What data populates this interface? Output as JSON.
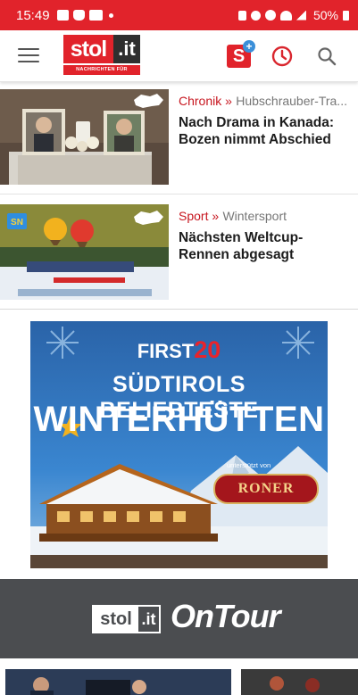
{
  "status_bar": {
    "time": "15:49",
    "battery": "50%"
  },
  "header": {
    "logo_main": "stol",
    "logo_suffix": ".it",
    "logo_tagline": "NACHRICHTEN FÜR SÜDTIROL",
    "splus_letter": "S",
    "splus_plus": "+"
  },
  "articles": [
    {
      "category": "Chronik »",
      "subcategory": "Hubschrauber-Tra...",
      "headline": "Nach Drama in Kanada: Bozen nimmt Abschied"
    },
    {
      "category": "Sport »",
      "subcategory": "Wintersport",
      "headline": "Nächsten Weltcup-Rennen abgesagt",
      "badge": "SN"
    }
  ],
  "ad": {
    "first_label": "FIRST",
    "first_number": "20",
    "line1": "SÜDTIROLS BELIEBTESTE",
    "line2": "WINTERHÜTTEN",
    "supported_by": "unterstützt von",
    "sponsor": "RONER"
  },
  "ontour": {
    "logo_main": "stol",
    "logo_suffix": ".it",
    "title": "OnTour"
  },
  "colors": {
    "brand_red": "#e1232b",
    "category_red": "#c7161f",
    "ontour_gray": "#4b4d50"
  }
}
